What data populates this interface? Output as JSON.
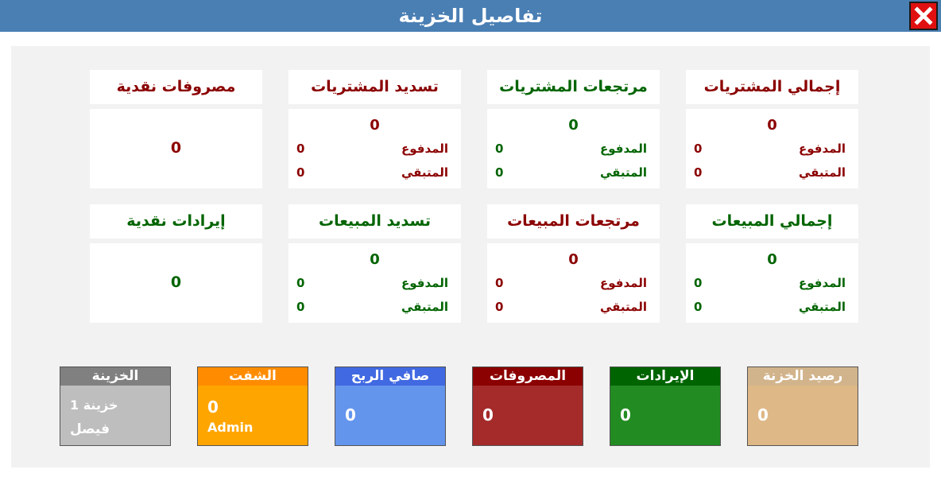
{
  "window": {
    "title": "تفاصيل الخزينة"
  },
  "colors": {
    "titlebar": "#4a7fb4",
    "dark_red": "#8b0000",
    "dark_green": "#006400",
    "close": "#e01010"
  },
  "labels": {
    "paid": "المدفوع",
    "remaining": "المتبقي"
  },
  "purchases": {
    "total": {
      "title": "إجمالي المشتريات",
      "value": "0",
      "paid": "0",
      "remaining": "0"
    },
    "returns": {
      "title": "مرتجعات المشتريات",
      "value": "0",
      "paid": "0",
      "remaining": "0"
    },
    "payment": {
      "title": "تسديد المشتريات",
      "value": "0",
      "paid": "0",
      "remaining": "0"
    },
    "cash_expenses": {
      "title": "مصروفات نقدية",
      "value": "0"
    }
  },
  "sales": {
    "total": {
      "title": "إجمالي المبيعات",
      "value": "0",
      "paid": "0",
      "remaining": "0"
    },
    "returns": {
      "title": "مرتجعات المبيعات",
      "value": "0",
      "paid": "0",
      "remaining": "0"
    },
    "payment": {
      "title": "تسديد المبيعات",
      "value": "0",
      "paid": "0",
      "remaining": "0"
    },
    "cash_revenue": {
      "title": "إيرادات نقدية",
      "value": "0"
    }
  },
  "summary": {
    "balance": {
      "title": "رصيد الخزنة",
      "value": "0",
      "color": "#deb887",
      "head_color": "#d2b48c"
    },
    "revenue": {
      "title": "الإيرادات",
      "value": "0",
      "color": "#228b22",
      "head_color": "#006400"
    },
    "expenses": {
      "title": "المصروفات",
      "value": "0",
      "color": "#a52a2a",
      "head_color": "#8b0000"
    },
    "net_profit": {
      "title": "صافي الربح",
      "value": "0",
      "color": "#6495ed",
      "head_color": "#4169e1"
    },
    "shift": {
      "title": "الشفت",
      "value": "0",
      "user": "Admin",
      "color": "#ffa500",
      "head_color": "#ff8c00"
    },
    "treasury": {
      "title": "الخزينة",
      "name": "خزينة 1",
      "user": "فيصل",
      "color": "#bebebe",
      "head_color": "#808080"
    }
  }
}
